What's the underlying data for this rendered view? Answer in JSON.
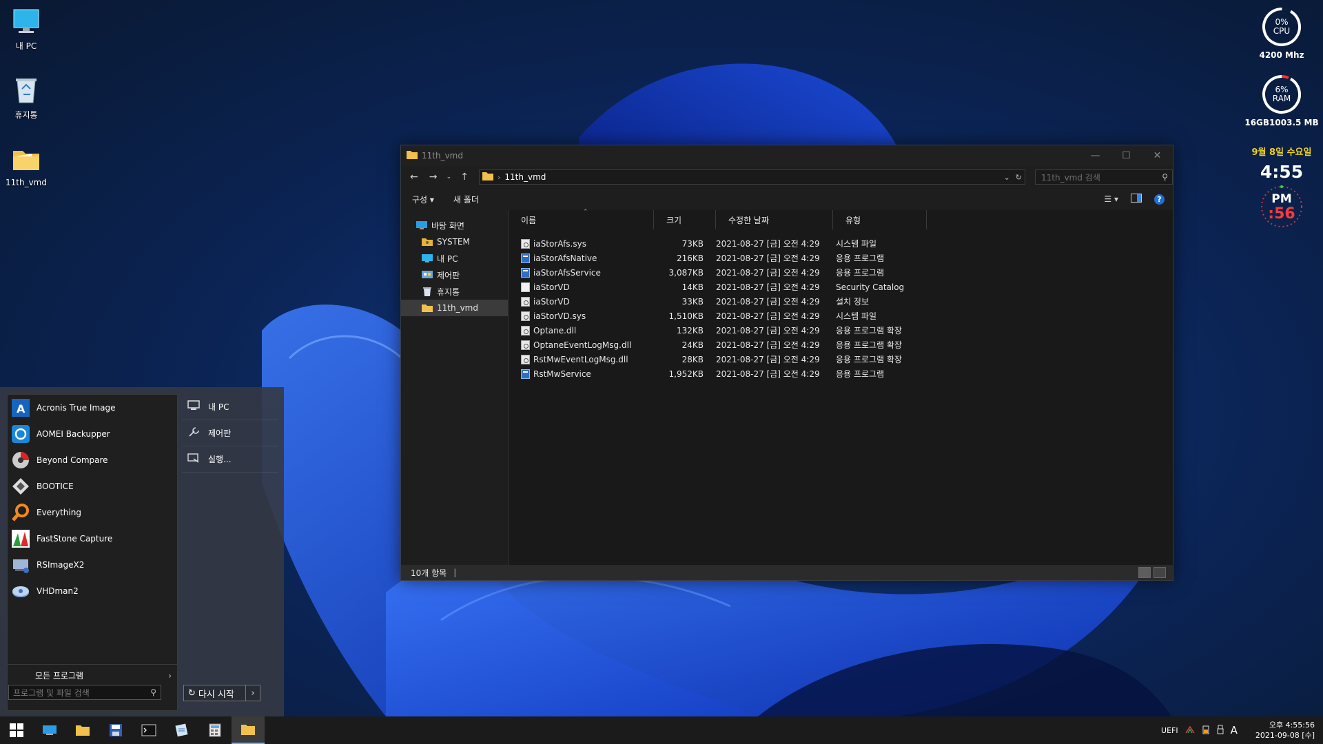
{
  "desktop": {
    "icons": [
      {
        "label": "내 PC",
        "icon": "monitor-icon"
      },
      {
        "label": "휴지통",
        "icon": "recycle-bin-icon"
      },
      {
        "label": "11th_vmd",
        "icon": "folder-icon"
      }
    ]
  },
  "widgets": {
    "cpu": {
      "percent_label": "0%",
      "name": "CPU",
      "freq": "4200 Mhz",
      "level": 0
    },
    "ram": {
      "percent_label": "6%",
      "name": "RAM",
      "detail": "16GB1003.5 MB",
      "level": 6
    },
    "date": "9월 8일 수요일",
    "time": "4:55",
    "ampm": "PM",
    "seconds": ":56",
    "colors": {
      "date": "#f2d21c",
      "seconds": "#ff3a3a"
    }
  },
  "explorer": {
    "title": "11th_vmd",
    "address": "11th_vmd",
    "search_placeholder": "11th_vmd 검색",
    "commands": {
      "organize": "구성 ▾",
      "new_folder": "새 폴더"
    },
    "nav": [
      {
        "label": "바탕 화면",
        "icon": "desktop-icon",
        "child": false
      },
      {
        "label": "SYSTEM",
        "icon": "user-folder-icon",
        "child": true
      },
      {
        "label": "내 PC",
        "icon": "monitor-icon",
        "child": true
      },
      {
        "label": "제어판",
        "icon": "control-panel-icon",
        "child": true
      },
      {
        "label": "휴지통",
        "icon": "recycle-bin-icon",
        "child": true
      },
      {
        "label": "11th_vmd",
        "icon": "folder-icon",
        "child": true,
        "selected": true
      }
    ],
    "columns": {
      "name": "이름",
      "size": "크기",
      "date": "수정한 날짜",
      "type": "유형"
    },
    "files": [
      {
        "name": "iaStorAfs.sys",
        "size": "73KB",
        "date": "2021-08-27 [금] 오전 4:29",
        "type": "시스템 파일",
        "kind": "sys"
      },
      {
        "name": "iaStorAfsNative",
        "size": "216KB",
        "date": "2021-08-27 [금] 오전 4:29",
        "type": "응용 프로그램",
        "kind": "app"
      },
      {
        "name": "iaStorAfsService",
        "size": "3,087KB",
        "date": "2021-08-27 [금] 오전 4:29",
        "type": "응용 프로그램",
        "kind": "app"
      },
      {
        "name": "iaStorVD",
        "size": "14KB",
        "date": "2021-08-27 [금] 오전 4:29",
        "type": "Security Catalog",
        "kind": "file"
      },
      {
        "name": "iaStorVD",
        "size": "33KB",
        "date": "2021-08-27 [금] 오전 4:29",
        "type": "설치 정보",
        "kind": "sys"
      },
      {
        "name": "iaStorVD.sys",
        "size": "1,510KB",
        "date": "2021-08-27 [금] 오전 4:29",
        "type": "시스템 파일",
        "kind": "sys"
      },
      {
        "name": "Optane.dll",
        "size": "132KB",
        "date": "2021-08-27 [금] 오전 4:29",
        "type": "응용 프로그램 확장",
        "kind": "sys"
      },
      {
        "name": "OptaneEventLogMsg.dll",
        "size": "24KB",
        "date": "2021-08-27 [금] 오전 4:29",
        "type": "응용 프로그램 확장",
        "kind": "sys"
      },
      {
        "name": "RstMwEventLogMsg.dll",
        "size": "28KB",
        "date": "2021-08-27 [금] 오전 4:29",
        "type": "응용 프로그램 확장",
        "kind": "sys"
      },
      {
        "name": "RstMwService",
        "size": "1,952KB",
        "date": "2021-08-27 [금] 오전 4:29",
        "type": "응용 프로그램",
        "kind": "app"
      }
    ],
    "status": "10개 항목"
  },
  "startmenu": {
    "programs": [
      {
        "label": "Acronis True Image",
        "icon": "acronis-icon"
      },
      {
        "label": "AOMEI Backupper",
        "icon": "aomei-icon"
      },
      {
        "label": "Beyond Compare",
        "icon": "beyond-compare-icon"
      },
      {
        "label": "BOOTICE",
        "icon": "bootice-icon"
      },
      {
        "label": "Everything",
        "icon": "everything-icon"
      },
      {
        "label": "FastStone Capture",
        "icon": "faststone-icon"
      },
      {
        "label": "RSImageX2",
        "icon": "rsimagex-icon"
      },
      {
        "label": "VHDman2",
        "icon": "vhdman-icon"
      }
    ],
    "all_programs": "모든 프로그램",
    "search_placeholder": "프로그램 및 파일 검색",
    "system": [
      {
        "label": "내 PC",
        "icon": "monitor-icon"
      },
      {
        "label": "제어판",
        "icon": "wrench-icon"
      },
      {
        "label": "실행...",
        "icon": "run-icon"
      }
    ],
    "restart": "다시 시작"
  },
  "taskbar": {
    "tray_text": "UEFI",
    "ime": "A",
    "clock_time": "오후 4:55:56",
    "clock_date": "2021-09-08 [수]"
  }
}
